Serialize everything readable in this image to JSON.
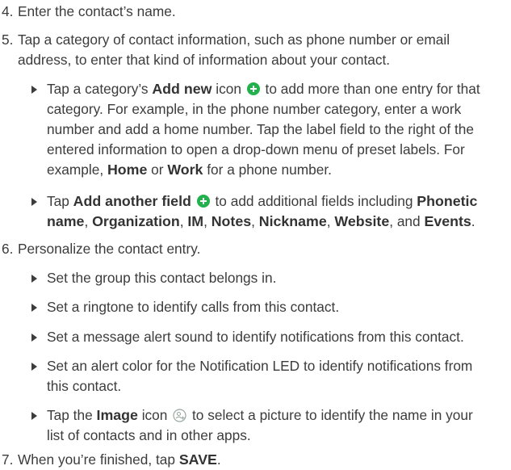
{
  "steps": {
    "s4": {
      "num": "4.",
      "text": "Enter the contact’s name."
    },
    "s5": {
      "num": "5.",
      "line1": "Tap a category of contact information, such as phone number or email",
      "line2": "address, to enter that kind of information about your contact."
    },
    "s6": {
      "num": "6.",
      "text": "Personalize the contact entry."
    },
    "s7": {
      "num": "7.",
      "pre": "When you’re finished, tap ",
      "save": "SAVE",
      "post": "."
    }
  },
  "b_addnew": {
    "pre": "Tap a category’s ",
    "em": "Add new",
    "mid": " icon ",
    "icon": "plus-circle-icon",
    "post1": " to add more than one entry for that",
    "l2": "category. For example, in the phone number category, enter a work",
    "l3": "number and add a home number. Tap the label field to the right of the",
    "l4": "entered information to open a drop-down menu of preset labels. For",
    "l5pre": "example, ",
    "home": "Home",
    "or": " or ",
    "work": "Work",
    "l5post": " for a phone number."
  },
  "b_field": {
    "pre": "Tap ",
    "em": "Add another field",
    "icon": "plus-circle-icon",
    "post1": " to add additional fields including ",
    "phonetic": "Phonetic",
    "name": "name",
    "c1": ", ",
    "org": "Organization",
    "c2": ", ",
    "im": "IM",
    "c3": ", ",
    "notes": "Notes",
    "c4": ", ",
    "nick": "Nickname",
    "c5": ", ",
    "web": "Website",
    "and": ", and ",
    "events": "Events",
    "end": "."
  },
  "b_group": "Set the group this contact belongs in.",
  "b_ring": "Set a ringtone to identify calls from this contact.",
  "b_msg": "Set a message alert sound to identify notifications from this contact.",
  "b_led": {
    "l1": "Set an alert color for the Notification LED to identify notifications from",
    "l2": "this contact."
  },
  "b_image": {
    "pre": "Tap the ",
    "em": "Image",
    "mid": " icon ",
    "icon": "add-image-icon",
    "post1": " to select a picture to identify the name in your",
    "l2": "list of contacts and in other apps."
  },
  "colors": {
    "text": "#3c3c3c",
    "icon_green": "#22b14c",
    "image_icon": "#9aa9a0"
  }
}
